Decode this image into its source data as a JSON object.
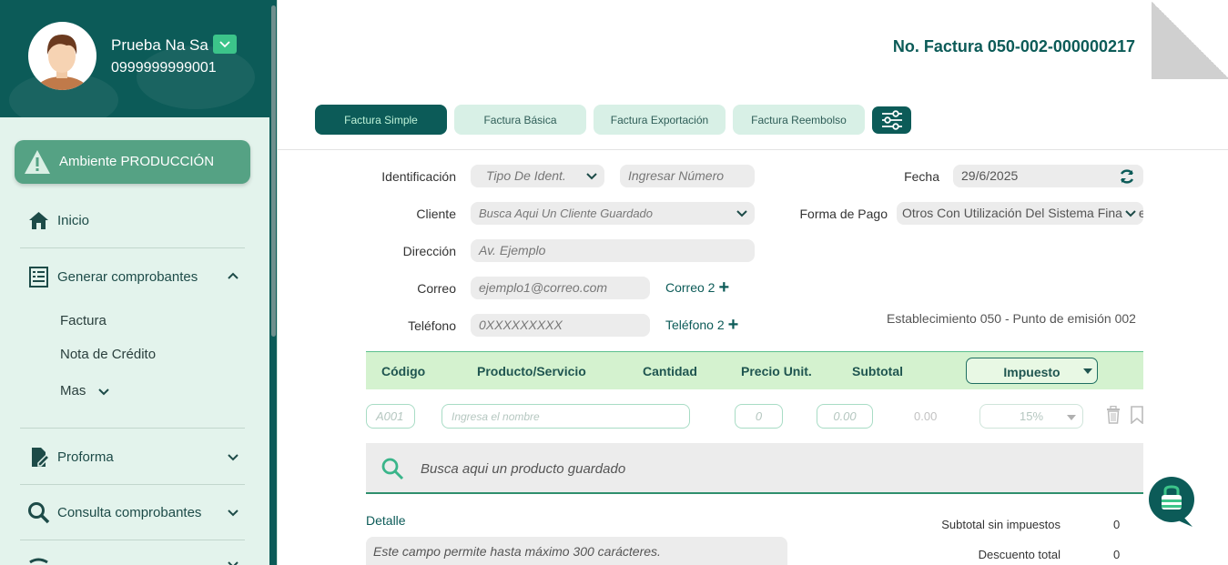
{
  "user": {
    "name": "Prueba Na Sa",
    "id": "0999999999001"
  },
  "environment": {
    "label": "Ambiente PRODUCCIÓN"
  },
  "sidebar": {
    "inicio": "Inicio",
    "generar": "Generar comprobantes",
    "factura": "Factura",
    "nota_credito": "Nota de Crédito",
    "mas": "Mas",
    "proforma": "Proforma",
    "consulta": "Consulta comprobantes"
  },
  "invoice": {
    "number": "No. Factura 050-002-000000217"
  },
  "tabs": [
    {
      "label": "Factura Simple",
      "active": true
    },
    {
      "label": "Factura Básica",
      "active": false
    },
    {
      "label": "Factura Exportación",
      "active": false
    },
    {
      "label": "Factura Reembolso",
      "active": false
    }
  ],
  "form": {
    "identificacion_label": "Identificación",
    "tipo_ident": "Tipo De Ident.",
    "numero_placeholder": "Ingresar Número",
    "cliente_label": "Cliente",
    "cliente_placeholder": "Busca Aqui Un Cliente Guardado",
    "direccion_label": "Dirección",
    "direccion_placeholder": "Av. Ejemplo",
    "correo_label": "Correo",
    "correo_placeholder": "ejemplo1@correo.com",
    "correo2": "Correo 2",
    "telefono_label": "Teléfono",
    "telefono_placeholder": "0XXXXXXXXX",
    "telefono2": "Teléfono 2",
    "fecha_label": "Fecha",
    "fecha_value": "29/6/2025",
    "forma_pago_label": "Forma de Pago",
    "forma_pago_value": "Otros Con Utilización Del Sistema Financiero",
    "establecimiento": "Establecimiento 050 - Punto de emisión 002"
  },
  "table": {
    "headers": [
      "Código",
      "Producto/Servicio",
      "Cantidad",
      "Precio Unit.",
      "Subtotal"
    ],
    "tax_header": "Impuesto",
    "row": {
      "code_placeholder": "A001",
      "name_placeholder": "Ingresa el nombre",
      "qty_placeholder": "0",
      "price_placeholder": "0.00",
      "subtotal": "0.00",
      "tax": "15%"
    }
  },
  "product_search": {
    "placeholder": "Busca aqui un producto guardado"
  },
  "detail": {
    "label": "Detalle",
    "placeholder": "Este campo permite hasta máximo 300 carácteres."
  },
  "totals": [
    {
      "label": "Subtotal sin impuestos",
      "value": "0"
    },
    {
      "label": "Descuento total",
      "value": "0"
    }
  ],
  "colors": {
    "primary": "#0c5b58",
    "accent": "#3cc48a",
    "env": "#55a284",
    "table_head": "#d4f2cf"
  }
}
